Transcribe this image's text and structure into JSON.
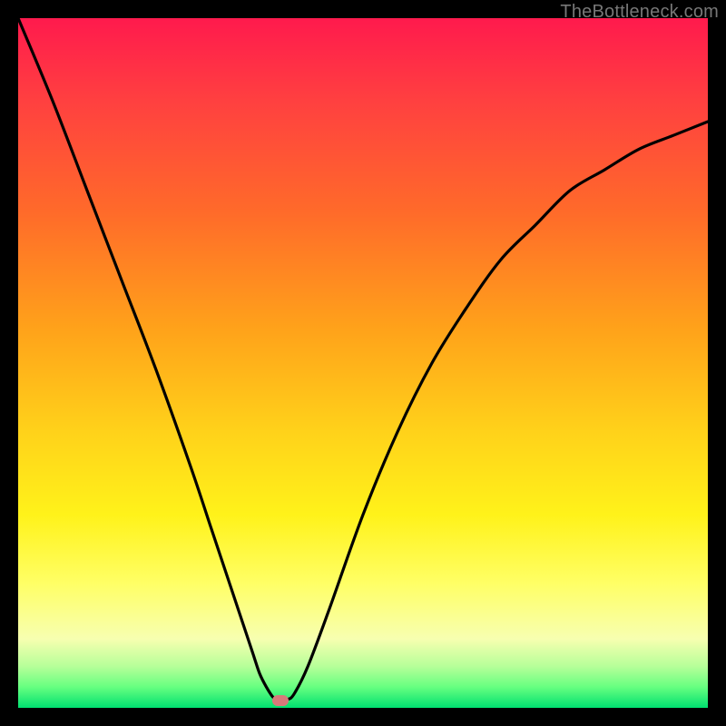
{
  "watermark": "TheBottleneck.com",
  "colors": {
    "frame": "#000000",
    "curve": "#000000",
    "marker": "#d77a7a",
    "gradient_top": "#ff1a4d",
    "gradient_bottom": "#00e070"
  },
  "chart_data": {
    "type": "line",
    "title": "",
    "xlabel": "",
    "ylabel": "",
    "xlim": [
      0,
      100
    ],
    "ylim": [
      0,
      100
    ],
    "grid": false,
    "legend": false,
    "marker": {
      "x": 38,
      "y": 1
    },
    "series": [
      {
        "name": "curve",
        "x": [
          0,
          5,
          10,
          15,
          20,
          25,
          28,
          30,
          32,
          34,
          35,
          36,
          37,
          38,
          39,
          40,
          42,
          45,
          50,
          55,
          60,
          65,
          70,
          75,
          80,
          85,
          90,
          95,
          100
        ],
        "values": [
          100,
          88,
          75,
          62,
          49,
          35,
          26,
          20,
          14,
          8,
          5,
          3,
          1.5,
          1,
          1.2,
          2,
          6,
          14,
          28,
          40,
          50,
          58,
          65,
          70,
          75,
          78,
          81,
          83,
          85
        ]
      }
    ]
  }
}
